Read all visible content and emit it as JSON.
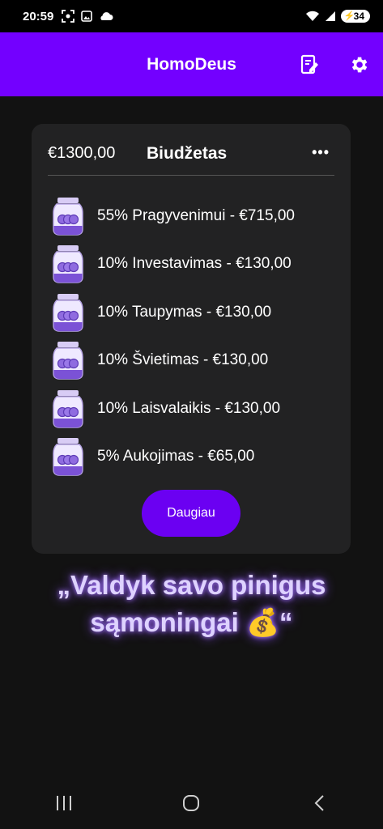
{
  "status_bar": {
    "time": "20:59",
    "battery": "34"
  },
  "app_bar": {
    "title": "HomoDeus"
  },
  "budget_card": {
    "total": "€1300,00",
    "title": "Biudžetas",
    "menu": "•••",
    "jars": [
      {
        "label": "55% Pragyvenimui - €715,00"
      },
      {
        "label": "10% Investavimas - €130,00"
      },
      {
        "label": "10% Taupymas - €130,00"
      },
      {
        "label": "10% Švietimas - €130,00"
      },
      {
        "label": "10% Laisvalaikis - €130,00"
      },
      {
        "label": "5% Aukojimas - €65,00"
      }
    ],
    "more_button": "Daugiau"
  },
  "quote": {
    "line1": "„Valdyk savo pinigus",
    "line2": "sąmoningai 💰“"
  },
  "colors": {
    "accent": "#7300ff",
    "card": "#222223",
    "background": "#121212",
    "quote_glow": "#8a4dff"
  },
  "icons": [
    "screenshot-icon",
    "image-icon",
    "cloud-icon",
    "wifi-icon",
    "signal-icon",
    "battery-icon",
    "edit-note-icon",
    "gear-icon",
    "jar-icon",
    "menu-dots-icon",
    "recents-icon",
    "home-icon",
    "back-icon"
  ]
}
